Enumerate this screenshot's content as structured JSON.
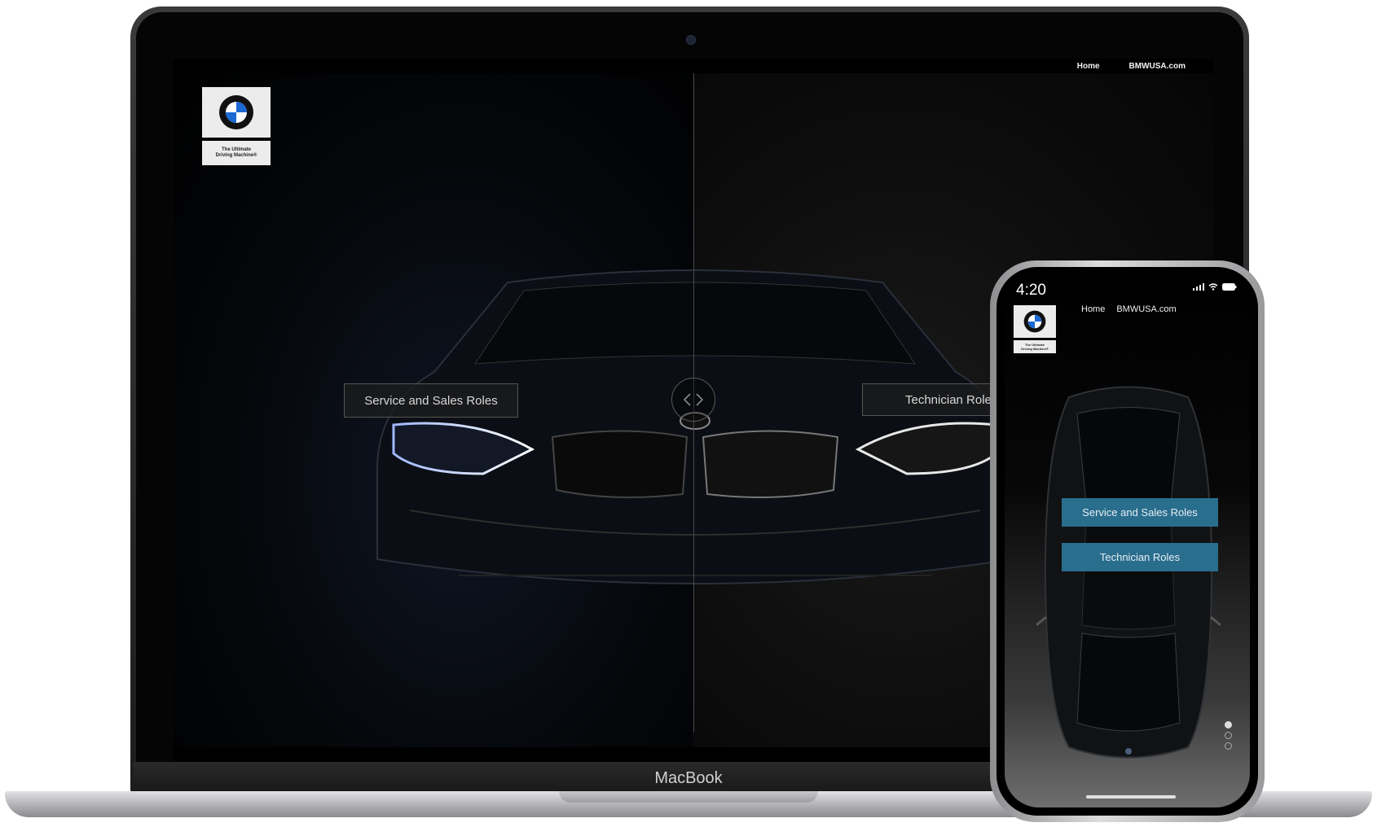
{
  "laptop": {
    "label": "MacBook",
    "nav": {
      "home": "Home",
      "site": "BMWUSA.com"
    },
    "logo": {
      "tagline_line1": "The Ultimate",
      "tagline_line2": "Driving Machine®"
    },
    "left_button": "Service and Sales Roles",
    "right_button": "Technician Roles"
  },
  "phone": {
    "time": "4:20",
    "nav": {
      "home": "Home",
      "site": "BMWUSA.com"
    },
    "logo": {
      "tagline_line1": "The Ultimate",
      "tagline_line2": "Driving Machine®"
    },
    "button_one": "Service and Sales Roles",
    "button_two": "Technician Roles",
    "active_slide": 1,
    "slide_count": 3
  },
  "colors": {
    "accent_button": "#2a6e8e",
    "background": "#000000"
  }
}
